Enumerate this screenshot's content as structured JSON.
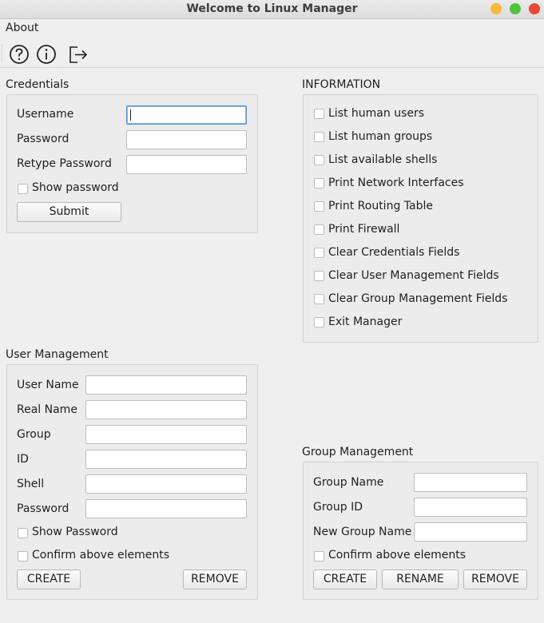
{
  "window": {
    "title": "Welcome to Linux Manager"
  },
  "menubar": {
    "about": "About"
  },
  "toolbar": {
    "icons": [
      "help-icon",
      "info-icon",
      "exit-icon"
    ]
  },
  "credentials": {
    "title": "Credentials",
    "username_label": "Username",
    "password_label": "Password",
    "retype_label": "Retype Password",
    "show_password": "Show password",
    "submit": "Submit"
  },
  "information": {
    "title": "INFORMATION",
    "items": [
      "List human users",
      "List human groups",
      "List available shells",
      "Print Network Interfaces",
      "Print Routing Table",
      "Print Firewall",
      "Clear Credentials Fields",
      "Clear User Management Fields",
      "Clear Group Management Fields",
      "Exit Manager"
    ]
  },
  "user_management": {
    "title": "User Management",
    "user_name": "User Name",
    "real_name": "Real Name",
    "group": "Group",
    "id": "ID",
    "shell": "Shell",
    "password": "Password",
    "show_password": "Show Password",
    "confirm": "Confirm above elements",
    "create": "CREATE",
    "remove": "REMOVE"
  },
  "group_management": {
    "title": "Group Management",
    "group_name": "Group Name",
    "group_id": "Group ID",
    "new_group_name": "New Group Name",
    "confirm": "Confirm above elements",
    "create": "CREATE",
    "rename": "RENAME",
    "remove": "REMOVE"
  },
  "colors": {
    "focus": "#4a90d9",
    "close": "#e84a3a",
    "minimize": "#f6b93b",
    "maximize": "#4cc43a"
  }
}
